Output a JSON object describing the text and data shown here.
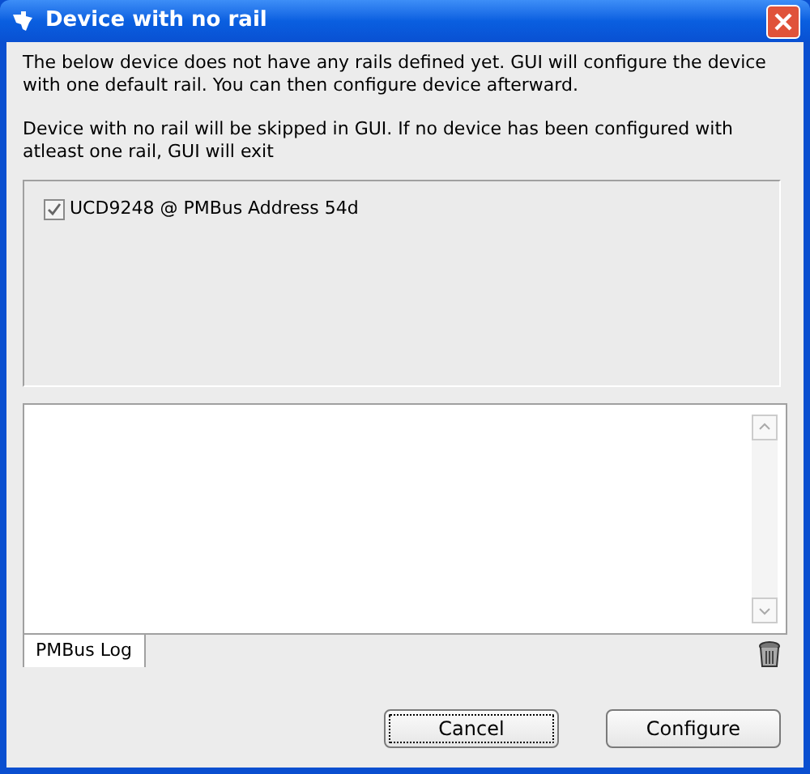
{
  "window": {
    "title": "Device with no rail"
  },
  "messages": [
    "The below device does not have any rails defined yet. GUI will configure the device with one default rail. You can then configure device afterward.",
    "Device with no rail will be skipped in GUI. If no device has been configured with atleast one rail, GUI will exit"
  ],
  "devices": [
    {
      "label": "UCD9248 @ PMBus Address 54d",
      "checked": true
    }
  ],
  "log_tabs": [
    {
      "label": "PMBus Log",
      "selected": true
    }
  ],
  "buttons": [
    {
      "label": "Cancel",
      "focused": true
    },
    {
      "label": "Configure",
      "focused": false
    }
  ]
}
